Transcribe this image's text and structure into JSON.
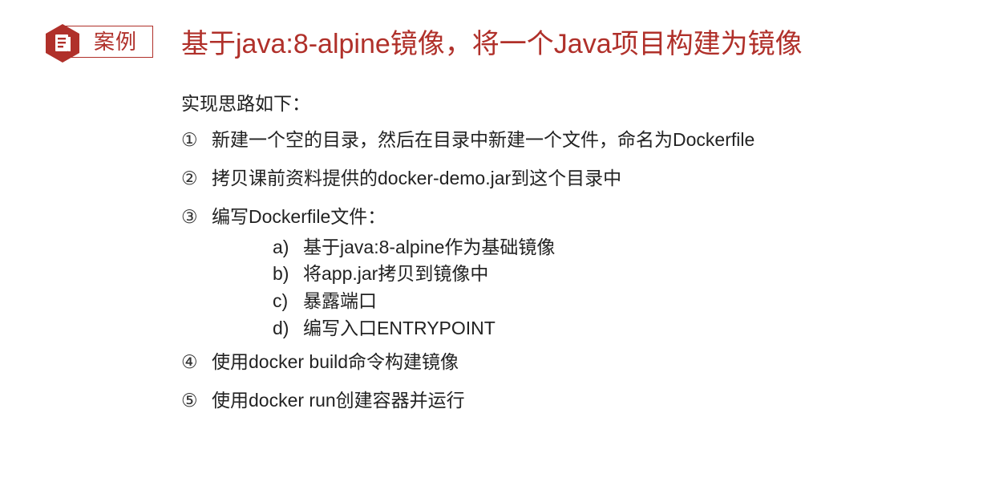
{
  "badge": {
    "label": "案例",
    "icon": "document-icon"
  },
  "title": "基于java:8-alpine镜像，将一个Java项目构建为镜像",
  "intro": "实现思路如下：",
  "steps": [
    {
      "num": "①",
      "text": "新建一个空的目录，然后在目录中新建一个文件，命名为Dockerfile"
    },
    {
      "num": "②",
      "text": "拷贝课前资料提供的docker-demo.jar到这个目录中"
    },
    {
      "num": "③",
      "text": "编写Dockerfile文件："
    },
    {
      "num": "④",
      "text": "使用docker build命令构建镜像"
    },
    {
      "num": "⑤",
      "text": "使用docker run创建容器并运行"
    }
  ],
  "substeps": [
    {
      "mark": "a)",
      "text": "基于java:8-alpine作为基础镜像"
    },
    {
      "mark": "b)",
      "text": "将app.jar拷贝到镜像中"
    },
    {
      "mark": "c)",
      "text": "暴露端口"
    },
    {
      "mark": "d)",
      "text": "编写入口ENTRYPOINT"
    }
  ],
  "colors": {
    "accent": "#b0302a",
    "text": "#222222"
  }
}
